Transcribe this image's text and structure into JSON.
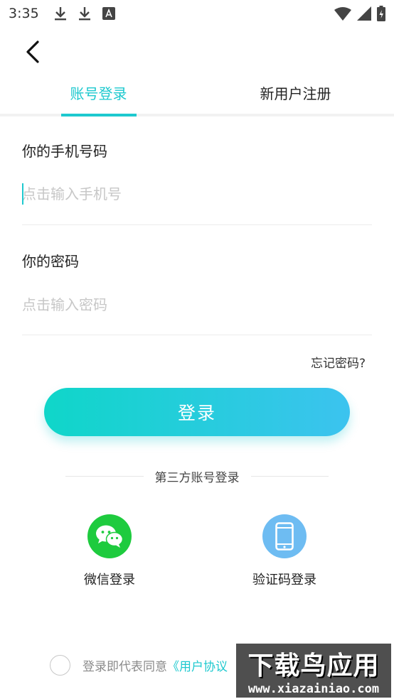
{
  "status_bar": {
    "time": "3:35"
  },
  "tabs": [
    {
      "label": "账号登录",
      "active": true
    },
    {
      "label": "新用户注册",
      "active": false
    }
  ],
  "phone": {
    "label": "你的手机号码",
    "placeholder": "点击输入手机号",
    "value": ""
  },
  "password": {
    "label": "你的密码",
    "placeholder": "点击输入密码",
    "value": ""
  },
  "forgot_password": "忘记密码?",
  "login_button": "登录",
  "third_party": {
    "title": "第三方账号登录",
    "options": [
      {
        "label": "微信登录",
        "icon": "wechat-icon",
        "color": "#1ecb3e"
      },
      {
        "label": "验证码登录",
        "icon": "phone-icon",
        "color": "#6ebcf2"
      }
    ]
  },
  "agreement": {
    "prefix": "登录即代表同意",
    "link": "《用户协议"
  },
  "watermark": {
    "main": "下载鸟应用",
    "url": "www.xiazainiao.com"
  },
  "colors": {
    "accent": "#1ec9cf",
    "button_gradient_start": "#0fd6c9",
    "button_gradient_end": "#3cc3ef"
  }
}
